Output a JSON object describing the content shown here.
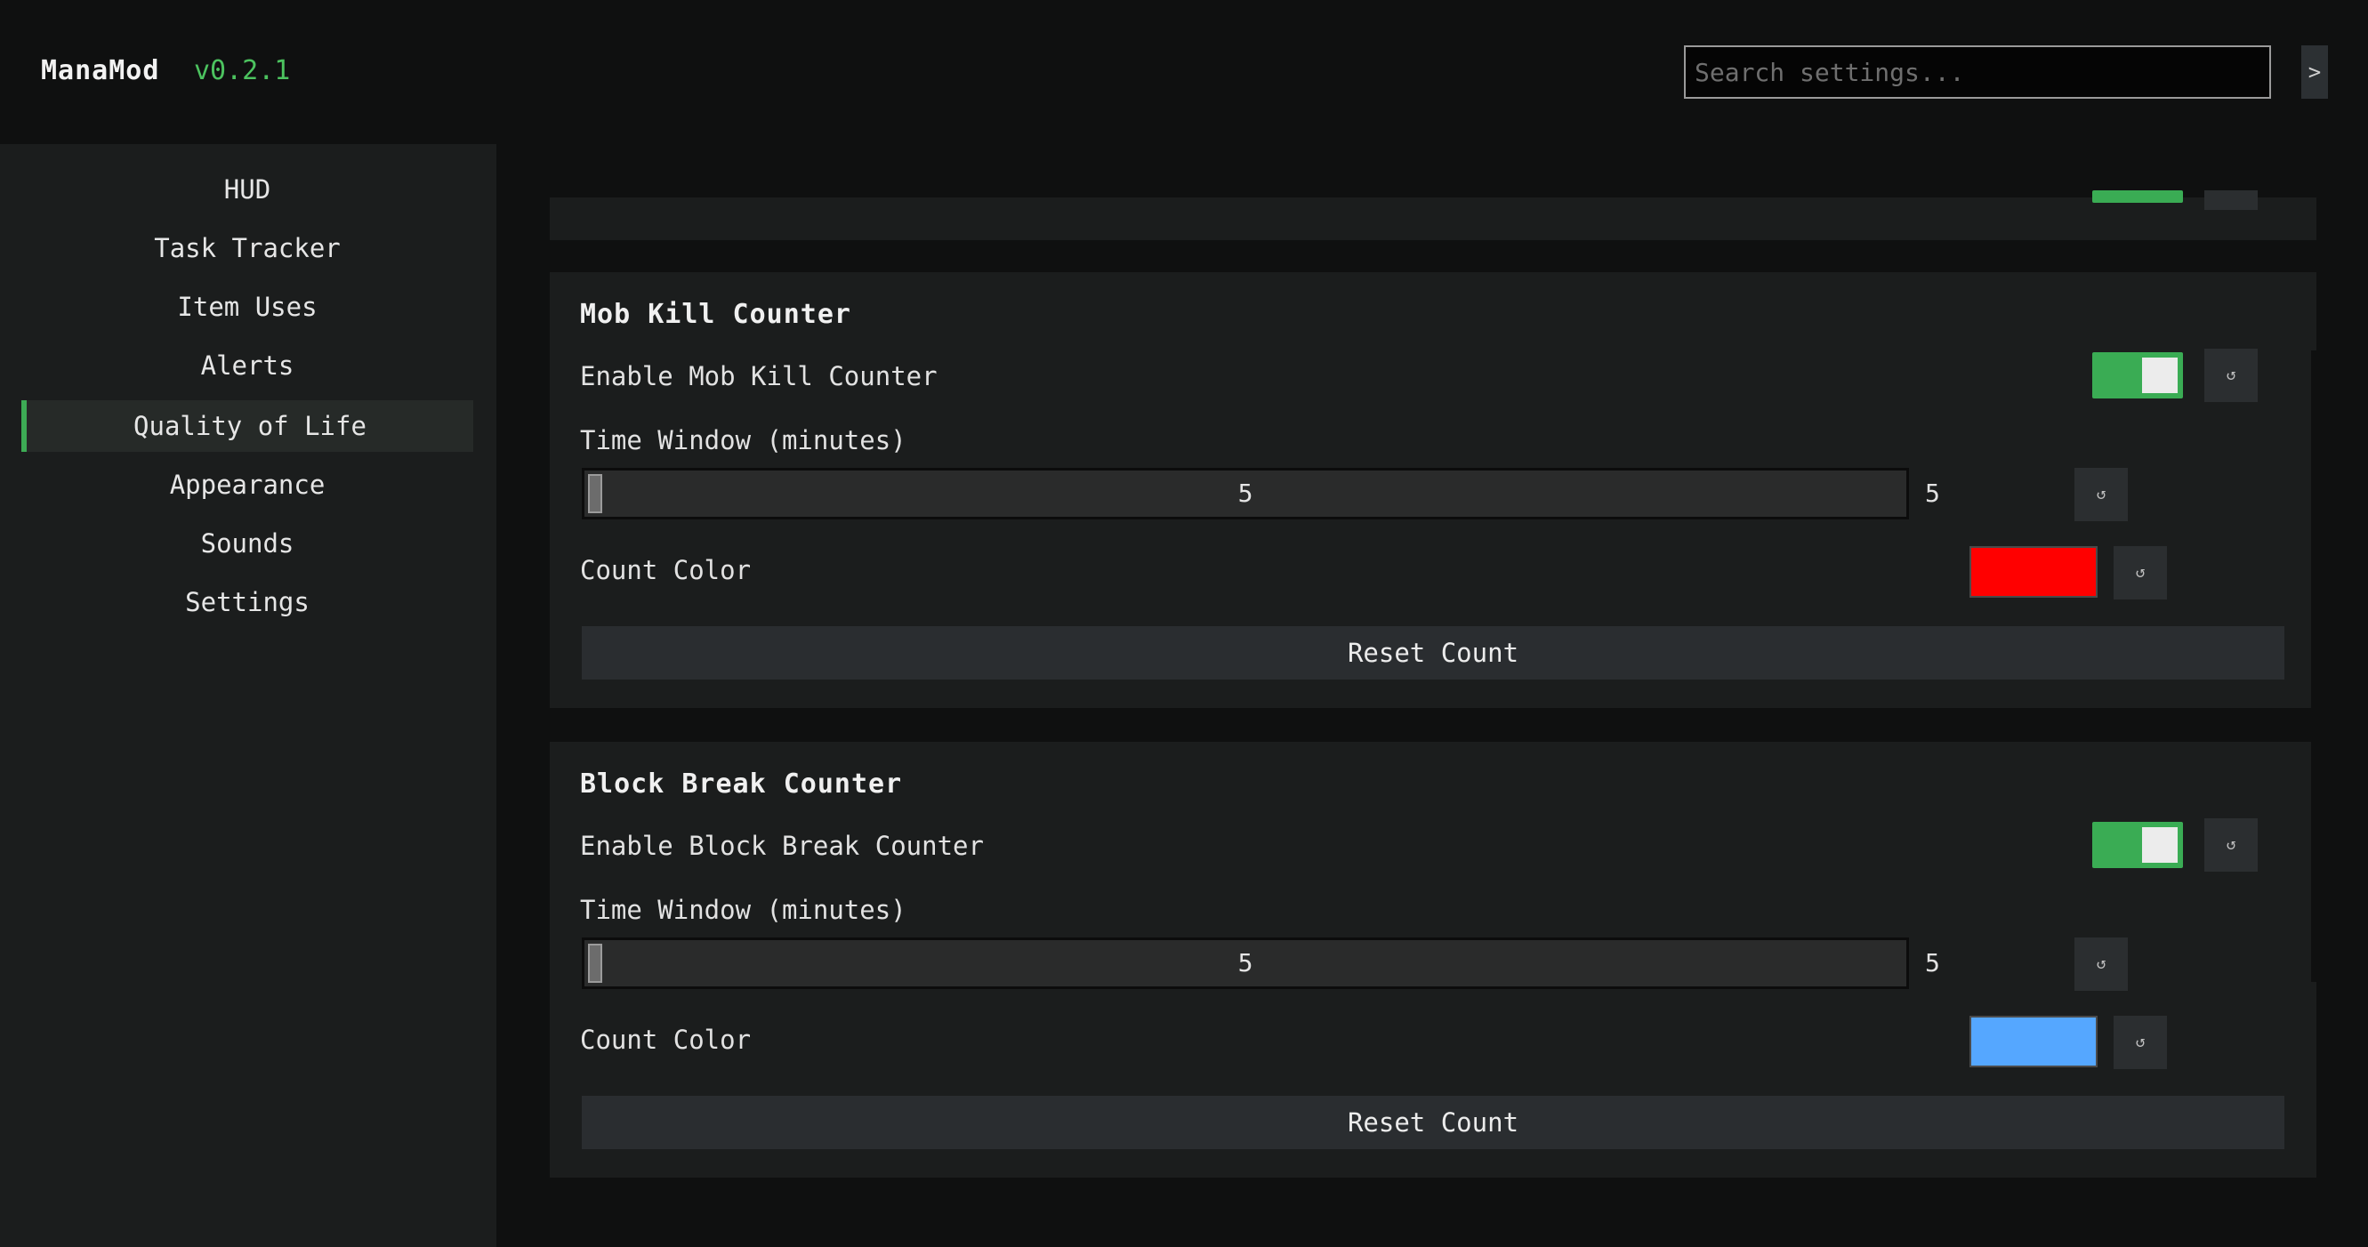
{
  "app": {
    "title": "ManaMod",
    "version": "v0.2.1"
  },
  "search": {
    "placeholder": "Search settings..."
  },
  "header": {
    "extra_button_label": ">"
  },
  "sidebar": {
    "items": [
      {
        "label": "HUD"
      },
      {
        "label": "Task Tracker"
      },
      {
        "label": "Item Uses"
      },
      {
        "label": "Alerts"
      },
      {
        "label": "Quality of Life"
      },
      {
        "label": "Appearance"
      },
      {
        "label": "Sounds"
      },
      {
        "label": "Settings"
      }
    ],
    "active": "Quality of Life"
  },
  "colors": {
    "accent": "#3aac54",
    "version": "#4cc35f",
    "mob_count_color": "#ff0000",
    "block_count_color": "#55a7ff"
  },
  "reset_icon": "reset-icon",
  "mob_kill_counter": {
    "title": "Mob Kill Counter",
    "enable_label": "Enable Mob Kill Counter",
    "enabled": true,
    "time_window_label": "Time Window (minutes)",
    "time_window_value": "5",
    "time_window_display": "5",
    "count_color_label": "Count Color",
    "count_color": "#ff0000",
    "reset_button": "Reset Count"
  },
  "block_break_counter": {
    "title": "Block Break Counter",
    "enable_label": "Enable Block Break Counter",
    "enabled": true,
    "time_window_label": "Time Window (minutes)",
    "time_window_value": "5",
    "time_window_display": "5",
    "count_color_label": "Count Color",
    "count_color": "#55a7ff",
    "reset_button": "Reset Count"
  }
}
